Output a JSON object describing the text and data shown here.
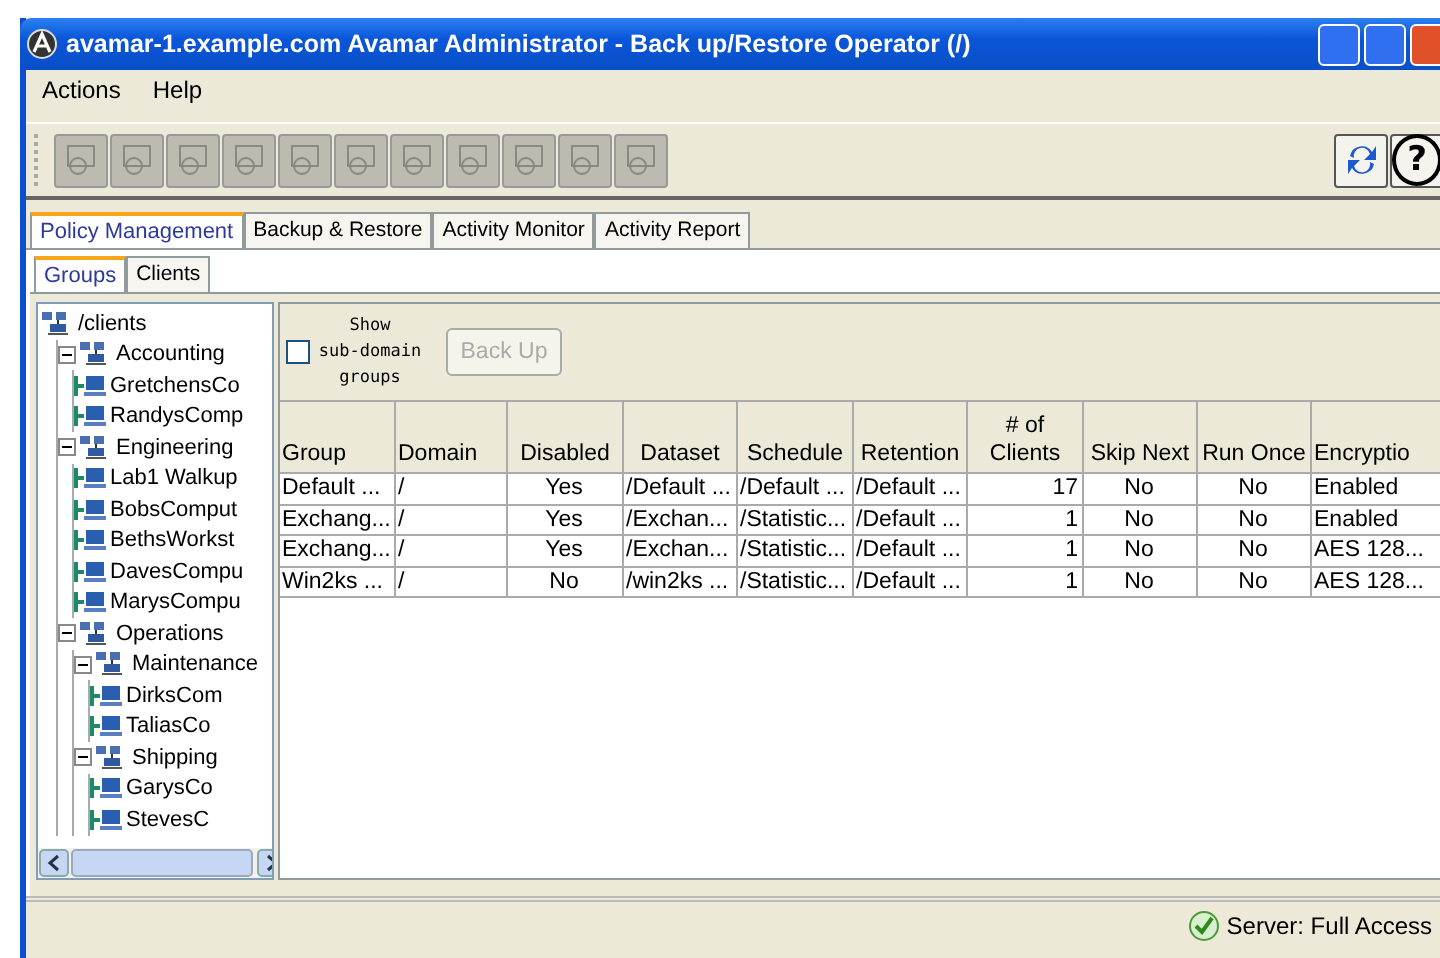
{
  "window": {
    "title": "avamar-1.example.com Avamar Administrator - Back up/Restore Operator (/)"
  },
  "menu": [
    "Actions",
    "Help"
  ],
  "toolbar": [
    {
      "kind": "generic",
      "disabled": true
    },
    {
      "kind": "generic",
      "disabled": true
    },
    {
      "kind": "generic",
      "disabled": true
    },
    {
      "kind": "generic",
      "disabled": true
    },
    {
      "kind": "generic",
      "disabled": true
    },
    {
      "kind": "generic",
      "disabled": true
    },
    {
      "kind": "generic",
      "disabled": true
    },
    {
      "kind": "generic",
      "disabled": true
    },
    {
      "kind": "generic",
      "disabled": true
    },
    {
      "kind": "generic",
      "disabled": true
    },
    {
      "kind": "generic",
      "disabled": true
    },
    {
      "kind": "refresh",
      "disabled": false
    },
    {
      "kind": "help",
      "label": "?",
      "disabled": false
    }
  ],
  "tabs": [
    {
      "label": "Policy Management",
      "selected": true
    },
    {
      "label": "Backup & Restore",
      "selected": false
    },
    {
      "label": "Activity Monitor",
      "selected": false
    },
    {
      "label": "Activity Report",
      "selected": false
    }
  ],
  "subtabs": [
    {
      "label": "Groups",
      "selected": true
    },
    {
      "label": "Clients",
      "selected": false
    }
  ],
  "tree": [
    {
      "label": "/clients",
      "kind": "group",
      "children": [
        {
          "label": "Accounting",
          "kind": "group",
          "expanded": true,
          "children": [
            {
              "label": "GretchensCo",
              "kind": "client"
            },
            {
              "label": "RandysComp",
              "kind": "client"
            }
          ]
        },
        {
          "label": "Engineering",
          "kind": "group",
          "expanded": true,
          "children": [
            {
              "label": "Lab1 Walkup",
              "kind": "client"
            },
            {
              "label": "BobsComput",
              "kind": "client"
            },
            {
              "label": "BethsWorkst",
              "kind": "client"
            },
            {
              "label": "DavesCompu",
              "kind": "client"
            },
            {
              "label": "MarysCompu",
              "kind": "client"
            }
          ]
        },
        {
          "label": "Operations",
          "kind": "group",
          "expanded": true,
          "children": [
            {
              "label": "Maintenance",
              "kind": "group",
              "expanded": true,
              "children": [
                {
                  "label": "DirksCom",
                  "kind": "client"
                },
                {
                  "label": "TaliasCo",
                  "kind": "client"
                }
              ]
            },
            {
              "label": "Shipping",
              "kind": "group",
              "expanded": true,
              "children": [
                {
                  "label": "GarysCo",
                  "kind": "client"
                },
                {
                  "label": "StevesC",
                  "kind": "client"
                }
              ]
            }
          ]
        }
      ]
    }
  ],
  "options": {
    "show_subdomain": {
      "label": "Show sub-domain groups",
      "checked": false
    },
    "back_up": {
      "label": "Back Up",
      "disabled": true
    }
  },
  "table": {
    "columns": [
      "Group",
      "Domain",
      "Disabled",
      "Dataset",
      "Schedule",
      "Retention",
      "# of Clients",
      "Skip Next",
      "Run Once",
      "Encryptio"
    ],
    "rows": [
      [
        "Default ...",
        "/",
        "Yes",
        "/Default ...",
        "/Default ...",
        "/Default ...",
        "17",
        "No",
        "No",
        "Enabled"
      ],
      [
        "Exchang...",
        "/",
        "Yes",
        "/Exchan...",
        "/Statistic...",
        "/Default ...",
        "1",
        "No",
        "No",
        "Enabled"
      ],
      [
        "Exchang...",
        "/",
        "Yes",
        "/Exchan...",
        "/Statistic...",
        "/Default ...",
        "1",
        "No",
        "No",
        "AES 128..."
      ],
      [
        "Win2ks ...",
        "/",
        "No",
        "/win2ks ...",
        "/Statistic...",
        "/Default ...",
        "1",
        "No",
        "No",
        "AES 128..."
      ]
    ]
  },
  "status_bar": {
    "text": "Server: Full Access"
  }
}
